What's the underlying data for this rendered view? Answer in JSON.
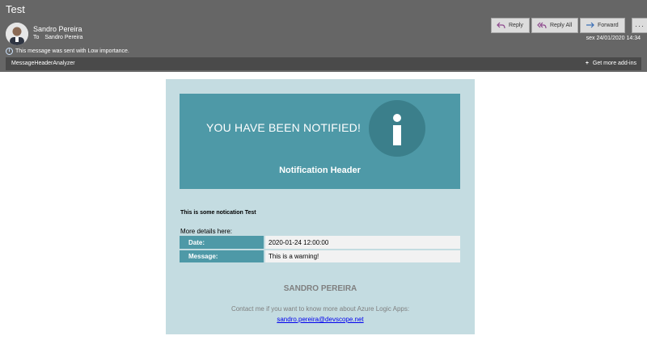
{
  "header": {
    "subject": "Test",
    "sender_name": "Sandro Pereira",
    "to_label": "To",
    "to_name": "Sandro Pereira",
    "importance_text": "This message was sent with Low importance.",
    "date": "sex 24/01/2020 14:34"
  },
  "actions": {
    "reply": "Reply",
    "reply_all": "Reply All",
    "forward": "Forward",
    "more": "···"
  },
  "addin_bar": {
    "name": "MessageHeaderAnalyzer",
    "more_addins": "Get more add-ins"
  },
  "email": {
    "banner_title": "YOU HAVE BEEN NOTIFIED!",
    "banner_header": "Notification Header",
    "note_title": "This is some notication Test",
    "more_details": "More details here:",
    "details": [
      {
        "key": "Date:",
        "value": "2020-01-24 12:00:00"
      },
      {
        "key": "Message:",
        "value": "This is a warning!"
      }
    ],
    "footer_name": "SANDRO PEREIRA",
    "footer_contact": "Contact me if you want to know more about Azure Logic Apps:",
    "footer_email": "sandro.pereira@devscope.net"
  },
  "colors": {
    "header_bg": "#666666",
    "addin_bar_bg": "#4a4a4a",
    "card_bg": "#c4dce1",
    "accent": "#4e99a7",
    "icon_circle": "#3b7f8b",
    "link": "#0000ee"
  },
  "icons": {
    "reply": "reply-arrow-icon",
    "reply_all": "reply-all-arrow-icon",
    "forward": "forward-arrow-icon",
    "info": "info-icon"
  }
}
